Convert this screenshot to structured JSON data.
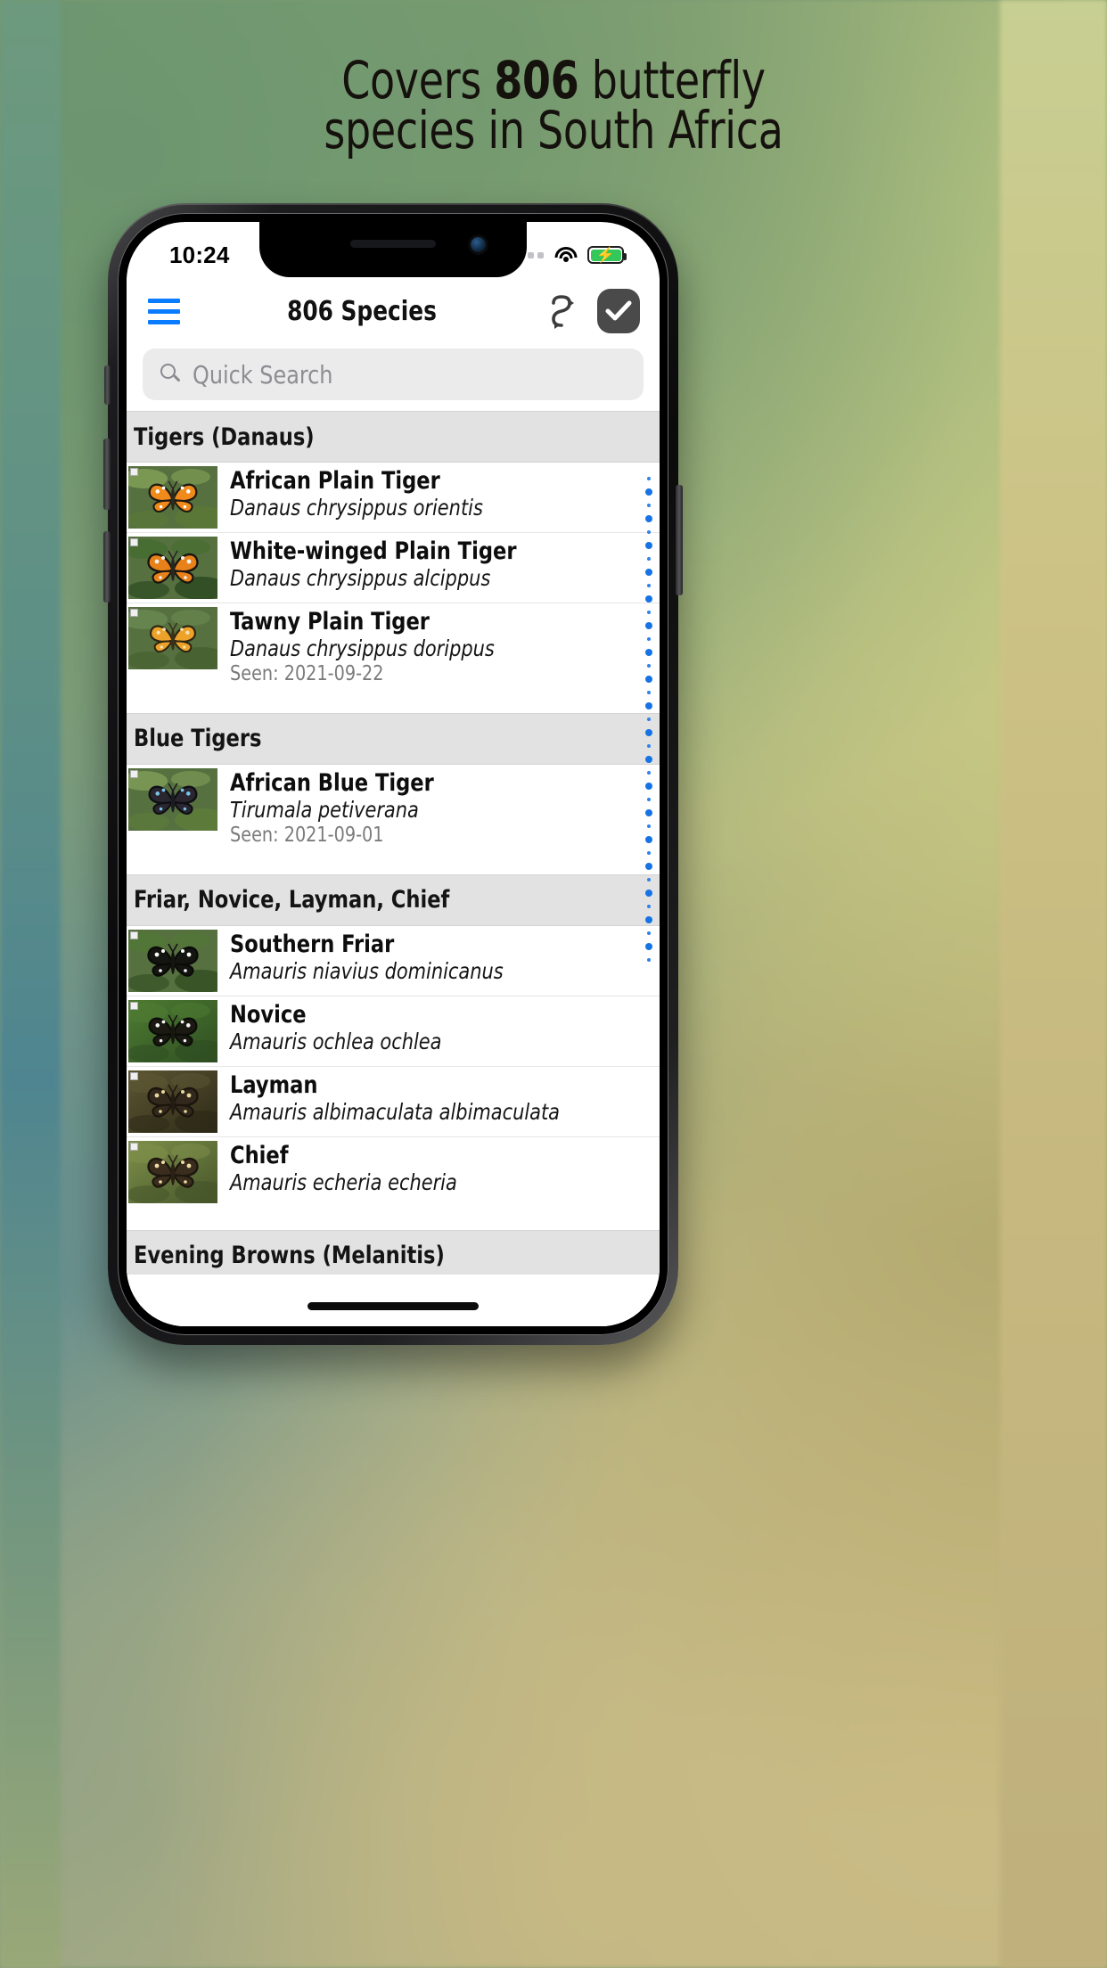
{
  "headline": {
    "line1_prefix": "Covers ",
    "line1_number": "806",
    "line1_suffix": " butterfly",
    "line2": "species in South Africa"
  },
  "status_bar": {
    "time": "10:24",
    "signal_icon": "signal-dots-icon",
    "wifi_icon": "wifi-icon",
    "battery_icon": "battery-charging-icon",
    "battery_color": "#34c759"
  },
  "nav_bar": {
    "menu_icon": "hamburger-menu-icon",
    "menu_color": "#0a7cff",
    "title": "806 Species",
    "sync_icon": "sync-swap-arrows-icon",
    "check_icon": "checkmark-icon",
    "check_button_color": "#4a4a4a"
  },
  "search": {
    "icon": "search-icon",
    "placeholder": "Quick Search",
    "value": ""
  },
  "sections": [
    {
      "title": "Tigers (Danaus)",
      "rows": [
        {
          "common": "African Plain Tiger",
          "latin": "Danaus chrysippus orientis",
          "seen": ""
        },
        {
          "common": "White-winged Plain Tiger",
          "latin": "Danaus chrysippus alcippus",
          "seen": ""
        },
        {
          "common": "Tawny Plain Tiger",
          "latin": "Danaus chrysippus dorippus",
          "seen": "Seen: 2021-09-22"
        }
      ]
    },
    {
      "title": "Blue Tigers",
      "rows": [
        {
          "common": "African Blue Tiger",
          "latin": "Tirumala petiverana",
          "seen": "Seen: 2021-09-01"
        }
      ]
    },
    {
      "title": "Friar, Novice, Layman, Chief",
      "rows": [
        {
          "common": "Southern Friar",
          "latin": "Amauris niavius dominicanus",
          "seen": ""
        },
        {
          "common": "Novice",
          "latin": "Amauris ochlea ochlea",
          "seen": ""
        },
        {
          "common": "Layman",
          "latin": "Amauris albimaculata albimaculata",
          "seen": ""
        },
        {
          "common": "Chief",
          "latin": "Amauris echeria echeria",
          "seen": ""
        }
      ]
    },
    {
      "title": "Evening Browns (Melanitis)",
      "rows": []
    }
  ],
  "index_scroll": {
    "dot_color": "#1673e6",
    "dot_count": 37
  }
}
